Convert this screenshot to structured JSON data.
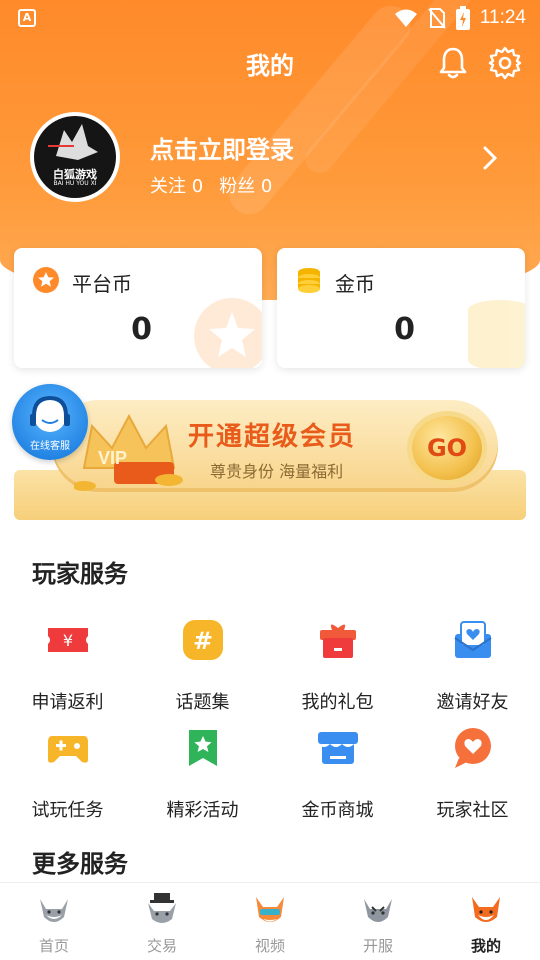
{
  "status_bar": {
    "time": "11:24",
    "app_icon": "A"
  },
  "header": {
    "title": "我的"
  },
  "profile": {
    "login_text": "点击立即登录",
    "follow_label": "关注 0",
    "fans_label": "粉丝 0",
    "avatar_logo_text": "白狐游戏",
    "avatar_logo_sub": "BAI HU YOU XI"
  },
  "wallet": {
    "platform_coin_label": "平台币",
    "platform_coin_value": "0",
    "gold_coin_label": "金币",
    "gold_coin_value": "0"
  },
  "vip_banner": {
    "title": "开通超级会员",
    "subtitle": "尊贵身份 海量福利",
    "go_label": "GO",
    "vip_text": "VIP"
  },
  "customer_service": {
    "label": "在线客服"
  },
  "player_services": {
    "title": "玩家服务",
    "items": [
      {
        "label": "申请返利",
        "icon": "ticket-icon"
      },
      {
        "label": "话题集",
        "icon": "hashtag-icon"
      },
      {
        "label": "我的礼包",
        "icon": "gift-icon"
      },
      {
        "label": "邀请好友",
        "icon": "invite-icon"
      },
      {
        "label": "试玩任务",
        "icon": "gamepad-icon"
      },
      {
        "label": "精彩活动",
        "icon": "bookmark-star-icon"
      },
      {
        "label": "金币商城",
        "icon": "store-icon"
      },
      {
        "label": "玩家社区",
        "icon": "heart-chat-icon"
      }
    ]
  },
  "more_services": {
    "title": "更多服务"
  },
  "bottom_nav": {
    "items": [
      {
        "label": "首页",
        "active": false
      },
      {
        "label": "交易",
        "active": false
      },
      {
        "label": "视频",
        "active": false
      },
      {
        "label": "开服",
        "active": false
      },
      {
        "label": "我的",
        "active": true
      }
    ]
  },
  "colors": {
    "brand_orange": "#ff8a2a",
    "vip_text": "#e85b1a"
  }
}
